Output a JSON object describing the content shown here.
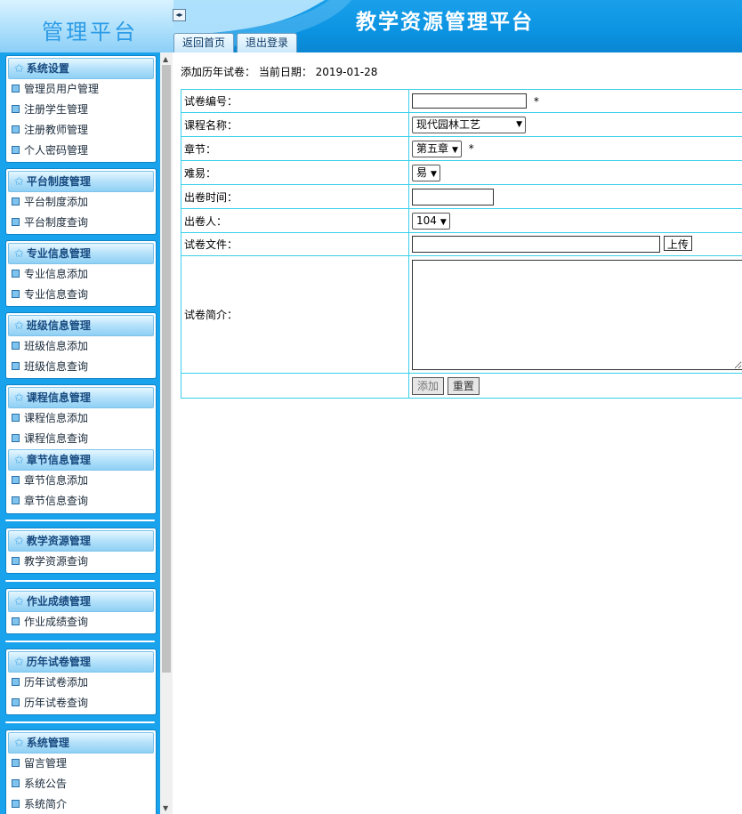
{
  "header": {
    "logo_text": "管理平台",
    "title": "教学资源管理平台",
    "toggle_glyph": "◂▸",
    "tabs": [
      "返回首页",
      "退出登录"
    ]
  },
  "sidebar": {
    "groups": [
      {
        "title": "系统设置",
        "items": [
          "管理员用户管理",
          "注册学生管理",
          "注册教师管理",
          "个人密码管理"
        ]
      },
      {
        "title": "平台制度管理",
        "items": [
          "平台制度添加",
          "平台制度查询"
        ]
      },
      {
        "title": "专业信息管理",
        "items": [
          "专业信息添加",
          "专业信息查询"
        ]
      },
      {
        "title": "班级信息管理",
        "items": [
          "班级信息添加",
          "班级信息查询"
        ]
      },
      {
        "title": "课程信息管理",
        "items": [
          "课程信息添加",
          "课程信息查询"
        ]
      },
      {
        "title": "章节信息管理",
        "items": [
          "章节信息添加",
          "章节信息查询"
        ]
      },
      {
        "title": "教学资源管理",
        "items": [
          "教学资源查询"
        ]
      },
      {
        "title": "作业成绩管理",
        "items": [
          "作业成绩查询"
        ]
      },
      {
        "title": "历年试卷管理",
        "items": [
          "历年试卷添加",
          "历年试卷查询"
        ]
      },
      {
        "title": "系统管理",
        "items": [
          "留言管理",
          "系统公告",
          "系统简介"
        ]
      }
    ]
  },
  "main": {
    "page_info": "添加历年试卷： 当前日期： 2019-01-28",
    "form": {
      "paper_no_label": "试卷编号：",
      "paper_no_value": "",
      "required_mark": "*",
      "course_label": "课程名称：",
      "course_value": "现代园林工艺",
      "chapter_label": "章节：",
      "chapter_value": "第五章",
      "difficulty_label": "难易：",
      "difficulty_value": "易",
      "exam_time_label": "出卷时间：",
      "exam_time_value": "",
      "author_label": "出卷人：",
      "author_value": "104",
      "file_label": "试卷文件：",
      "file_value": "",
      "upload_label": "上传",
      "intro_label": "试卷简介：",
      "intro_value": "",
      "add_label": "添加",
      "reset_label": "重置"
    }
  },
  "colors": {
    "sidebar_bg": "#18a3ec",
    "header_bg": "#0b93e2",
    "table_border": "#39d0ea"
  }
}
